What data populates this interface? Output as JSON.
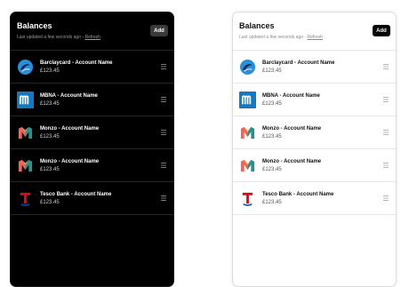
{
  "panels": {
    "dark": {
      "title": "Balances",
      "subtitle_prefix": "Last updated a few seconds ago - ",
      "refresh_label": "Refresh",
      "add_label": "Add",
      "accounts": [
        {
          "name": "Barclaycard - Account Name",
          "balance": "£123.45",
          "logo": "barclaycard-logo"
        },
        {
          "name": "MBNA - Account Name",
          "balance": "£123.45",
          "logo": "mbna-logo"
        },
        {
          "name": "Monzo - Account Name",
          "balance": "£123.45",
          "logo": "monzo-logo"
        },
        {
          "name": "Monzo - Account Name",
          "balance": "£123.45",
          "logo": "monzo-logo"
        },
        {
          "name": "Tesco Bank - Account Name",
          "balance": "£123.45",
          "logo": "tesco-bank-logo"
        }
      ]
    },
    "light": {
      "title": "Balances",
      "subtitle_prefix": "Last updated a few seconds ago - ",
      "refresh_label": "Refresh",
      "add_label": "Add",
      "accounts": [
        {
          "name": "Barclaycard - Account Name",
          "balance": "£123.45",
          "logo": "barclaycard-logo"
        },
        {
          "name": "MBNA - Account Name",
          "balance": "£123.45",
          "logo": "mbna-logo"
        },
        {
          "name": "Monzo - Account Name",
          "balance": "£123.45",
          "logo": "monzo-logo"
        },
        {
          "name": "Monzo - Account Name",
          "balance": "£123.45",
          "logo": "monzo-logo"
        },
        {
          "name": "Tesco Bank - Account Name",
          "balance": "£123.45",
          "logo": "tesco-bank-logo"
        }
      ]
    }
  },
  "colors": {
    "dark_background": "#000000",
    "light_background": "#ffffff",
    "barclaycard_blue": "#2a8fd6",
    "mbna_blue": "#1479c0",
    "monzo_coral": "#f0645a",
    "monzo_teal": "#2f8f8a",
    "tesco_red": "#e10a17"
  }
}
